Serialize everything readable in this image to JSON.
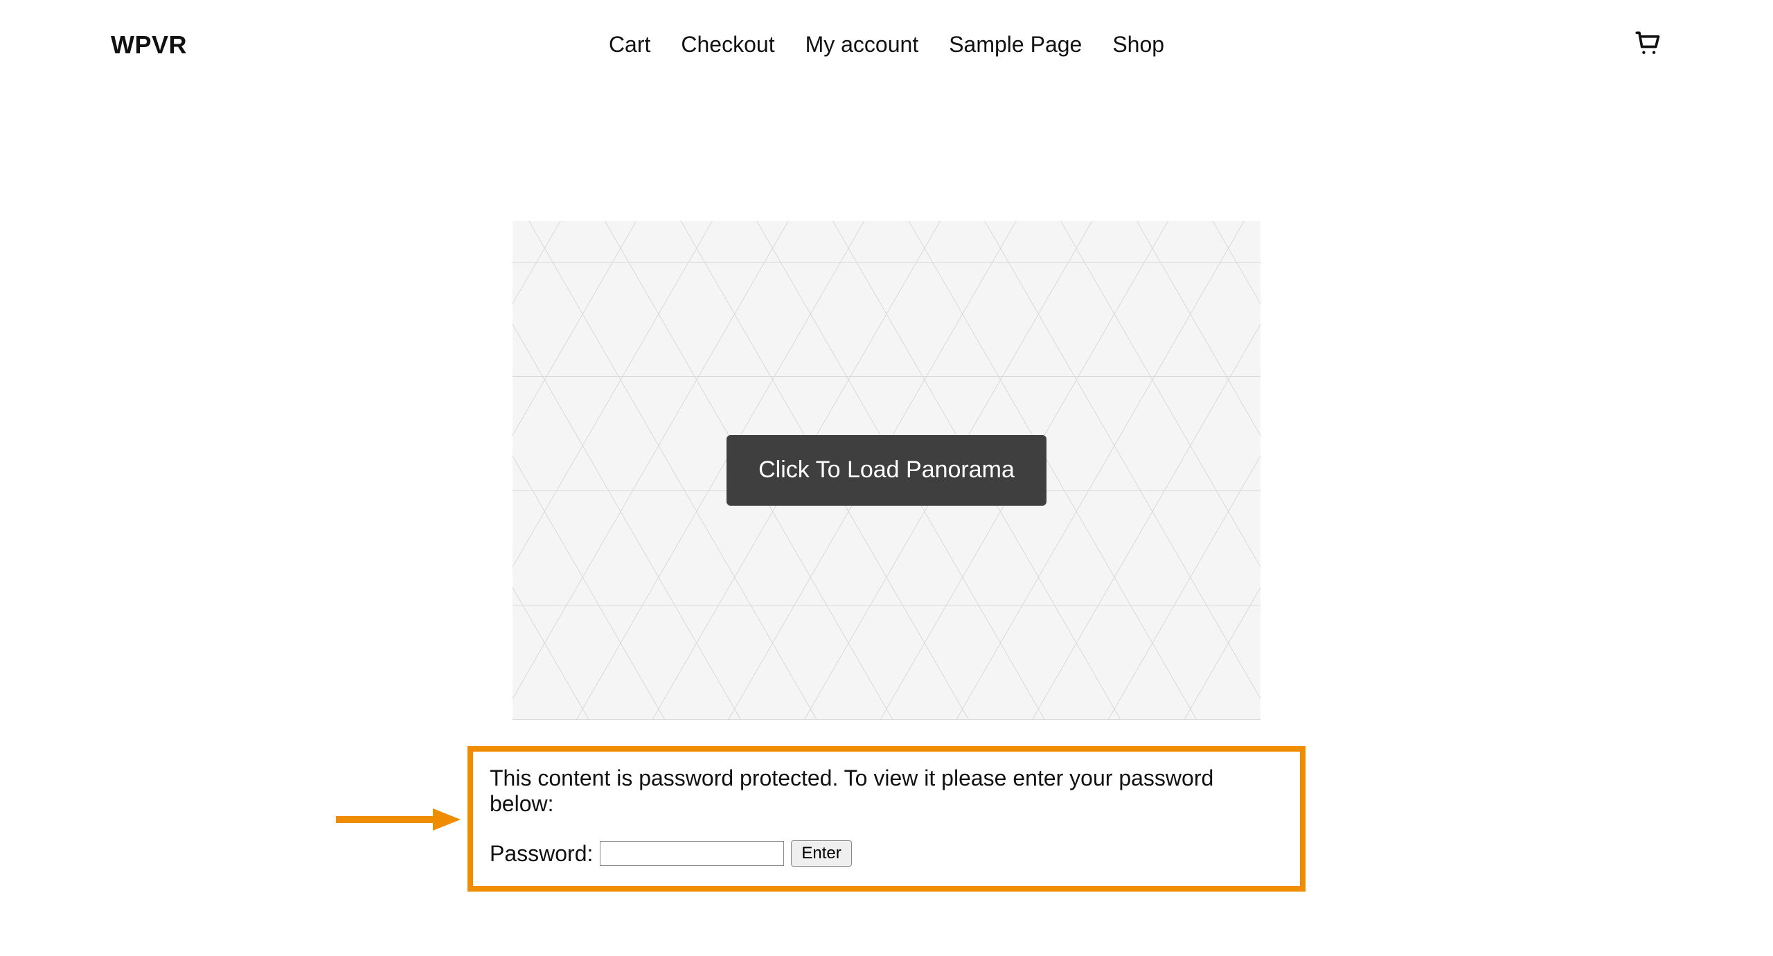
{
  "header": {
    "siteTitle": "WPVR",
    "nav": [
      {
        "label": "Cart"
      },
      {
        "label": "Checkout"
      },
      {
        "label": "My account"
      },
      {
        "label": "Sample Page"
      },
      {
        "label": "Shop"
      }
    ]
  },
  "panorama": {
    "loadButton": "Click To Load Panorama"
  },
  "protected": {
    "message": "This content is password protected. To view it please enter your password below:",
    "passwordLabel": "Password:",
    "enterButton": "Enter"
  },
  "colors": {
    "highlight": "#f08c00"
  }
}
